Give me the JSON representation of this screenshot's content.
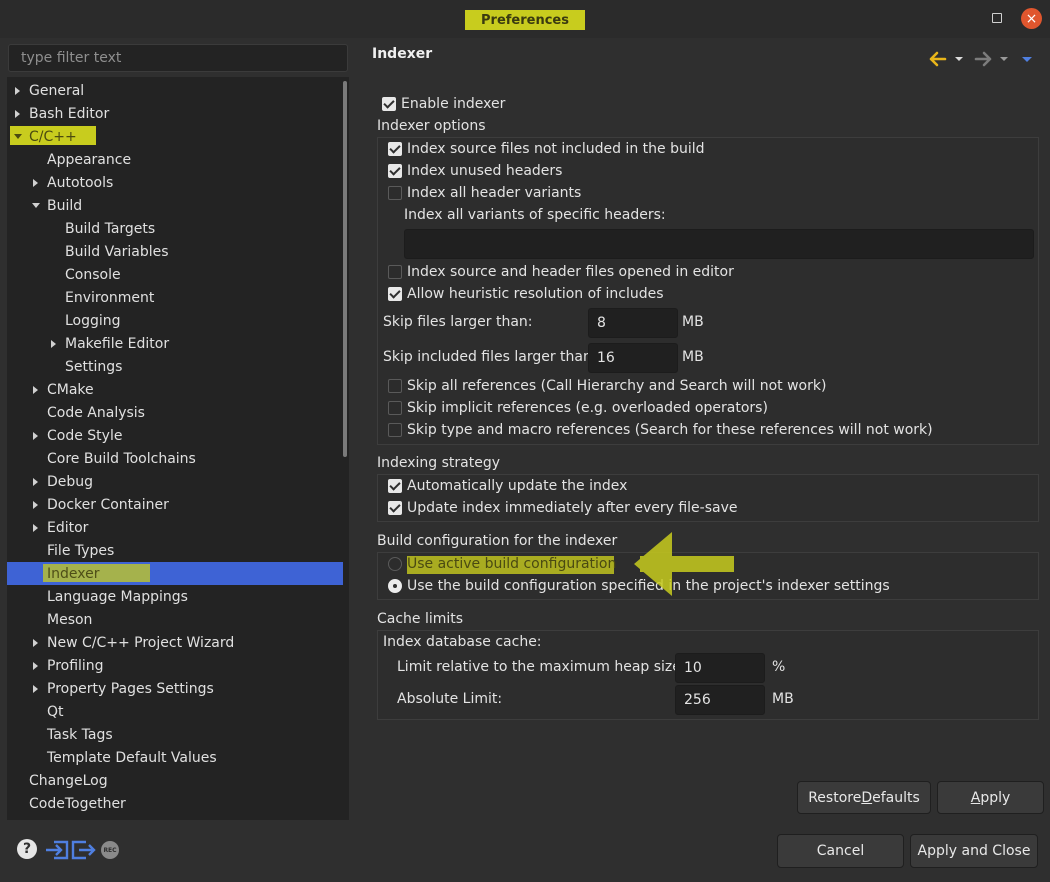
{
  "window": {
    "title": "Preferences",
    "maximize_icon": "maximize-icon",
    "close_icon": "close-icon",
    "close_glyph": "×"
  },
  "filter": {
    "placeholder": "type filter text"
  },
  "tree": {
    "items": [
      {
        "label": "General",
        "level": 0,
        "arrow": "right"
      },
      {
        "label": "Bash Editor",
        "level": 0,
        "arrow": "right"
      },
      {
        "label": "C/C++",
        "level": 0,
        "arrow": "down",
        "highlighted": true
      },
      {
        "label": "Appearance",
        "level": 1,
        "arrow": ""
      },
      {
        "label": "Autotools",
        "level": 1,
        "arrow": "right"
      },
      {
        "label": "Build",
        "level": 1,
        "arrow": "down"
      },
      {
        "label": "Build Targets",
        "level": 2,
        "arrow": ""
      },
      {
        "label": "Build Variables",
        "level": 2,
        "arrow": ""
      },
      {
        "label": "Console",
        "level": 2,
        "arrow": ""
      },
      {
        "label": "Environment",
        "level": 2,
        "arrow": ""
      },
      {
        "label": "Logging",
        "level": 2,
        "arrow": ""
      },
      {
        "label": "Makefile Editor",
        "level": 2,
        "arrow": "right"
      },
      {
        "label": "Settings",
        "level": 2,
        "arrow": ""
      },
      {
        "label": "CMake",
        "level": 1,
        "arrow": "right"
      },
      {
        "label": "Code Analysis",
        "level": 1,
        "arrow": ""
      },
      {
        "label": "Code Style",
        "level": 1,
        "arrow": "right"
      },
      {
        "label": "Core Build Toolchains",
        "level": 1,
        "arrow": ""
      },
      {
        "label": "Debug",
        "level": 1,
        "arrow": "right"
      },
      {
        "label": "Docker Container",
        "level": 1,
        "arrow": "right"
      },
      {
        "label": "Editor",
        "level": 1,
        "arrow": "right"
      },
      {
        "label": "File Types",
        "level": 1,
        "arrow": ""
      },
      {
        "label": "Indexer",
        "level": 1,
        "arrow": "",
        "selected": true
      },
      {
        "label": "Language Mappings",
        "level": 1,
        "arrow": ""
      },
      {
        "label": "Meson",
        "level": 1,
        "arrow": ""
      },
      {
        "label": "New C/C++ Project Wizard",
        "level": 1,
        "arrow": "right"
      },
      {
        "label": "Profiling",
        "level": 1,
        "arrow": "right"
      },
      {
        "label": "Property Pages Settings",
        "level": 1,
        "arrow": "right"
      },
      {
        "label": "Qt",
        "level": 1,
        "arrow": ""
      },
      {
        "label": "Task Tags",
        "level": 1,
        "arrow": ""
      },
      {
        "label": "Template Default Values",
        "level": 1,
        "arrow": ""
      },
      {
        "label": "ChangeLog",
        "level": 0,
        "arrow": ""
      },
      {
        "label": "CodeTogether",
        "level": 0,
        "arrow": ""
      }
    ]
  },
  "footer_icons": {
    "help": "help-icon",
    "help_glyph": "?",
    "import": "import-icon",
    "export": "export-icon",
    "record": "record-icon",
    "record_text": "REC"
  },
  "page": {
    "title": "Indexer",
    "nav": {
      "back": "back-arrow-icon",
      "forward": "forward-arrow-icon",
      "menu": "view-menu-icon"
    },
    "enable_indexer": {
      "label": "Enable indexer",
      "checked": true
    },
    "indexer_options": {
      "title": "Indexer options",
      "source_not_in_build": {
        "label": "Index source files not included in the build",
        "checked": true
      },
      "unused_headers": {
        "label": "Index unused headers",
        "checked": true
      },
      "all_header_variants": {
        "label": "Index all header variants",
        "checked": false
      },
      "specific_headers_label": "Index all variants of specific headers:",
      "specific_headers_value": "",
      "opened_in_editor": {
        "label": "Index source and header files opened in editor",
        "checked": false
      },
      "heuristic_includes": {
        "label": "Allow heuristic resolution of includes",
        "checked": true
      },
      "skip_files_larger": {
        "label": "Skip files larger than:",
        "value": "8",
        "unit": "MB"
      },
      "skip_included_larger": {
        "label": "Skip included files larger than:",
        "value": "16",
        "unit": "MB"
      },
      "skip_all_refs": {
        "label": "Skip all references (Call Hierarchy and Search will not work)",
        "checked": false
      },
      "skip_implicit_refs": {
        "label": "Skip implicit references (e.g. overloaded operators)",
        "checked": false
      },
      "skip_type_macro_refs": {
        "label": "Skip type and macro references (Search for these references will not work)",
        "checked": false
      }
    },
    "indexing_strategy": {
      "title": "Indexing strategy",
      "auto_update": {
        "label": "Automatically update the index",
        "checked": true
      },
      "update_on_save": {
        "label": "Update index immediately after every file-save",
        "checked": true
      }
    },
    "build_config": {
      "title": "Build configuration for the indexer",
      "use_active": {
        "label": "Use active build configuration",
        "selected": false
      },
      "use_specified": {
        "label": "Use the build configuration specified in the project's indexer settings",
        "selected": true
      }
    },
    "cache_limits": {
      "title": "Cache limits",
      "db_cache_label": "Index database cache:",
      "relative_limit": {
        "label": "Limit relative to the maximum heap size:",
        "value": "10",
        "unit": "%"
      },
      "absolute_limit": {
        "label": "Absolute Limit:",
        "value": "256",
        "unit": "MB"
      }
    }
  },
  "buttons": {
    "restore_defaults_pre": "Restore ",
    "restore_defaults_mn": "D",
    "restore_defaults_post": "efaults",
    "apply_mn": "A",
    "apply_post": "pply",
    "cancel": "Cancel",
    "apply_and_close": "Apply and Close"
  },
  "colors": {
    "annotation_highlight": "#c8cc1e",
    "selection": "#3e63d5",
    "nav_arrow": "#e9b61a"
  }
}
